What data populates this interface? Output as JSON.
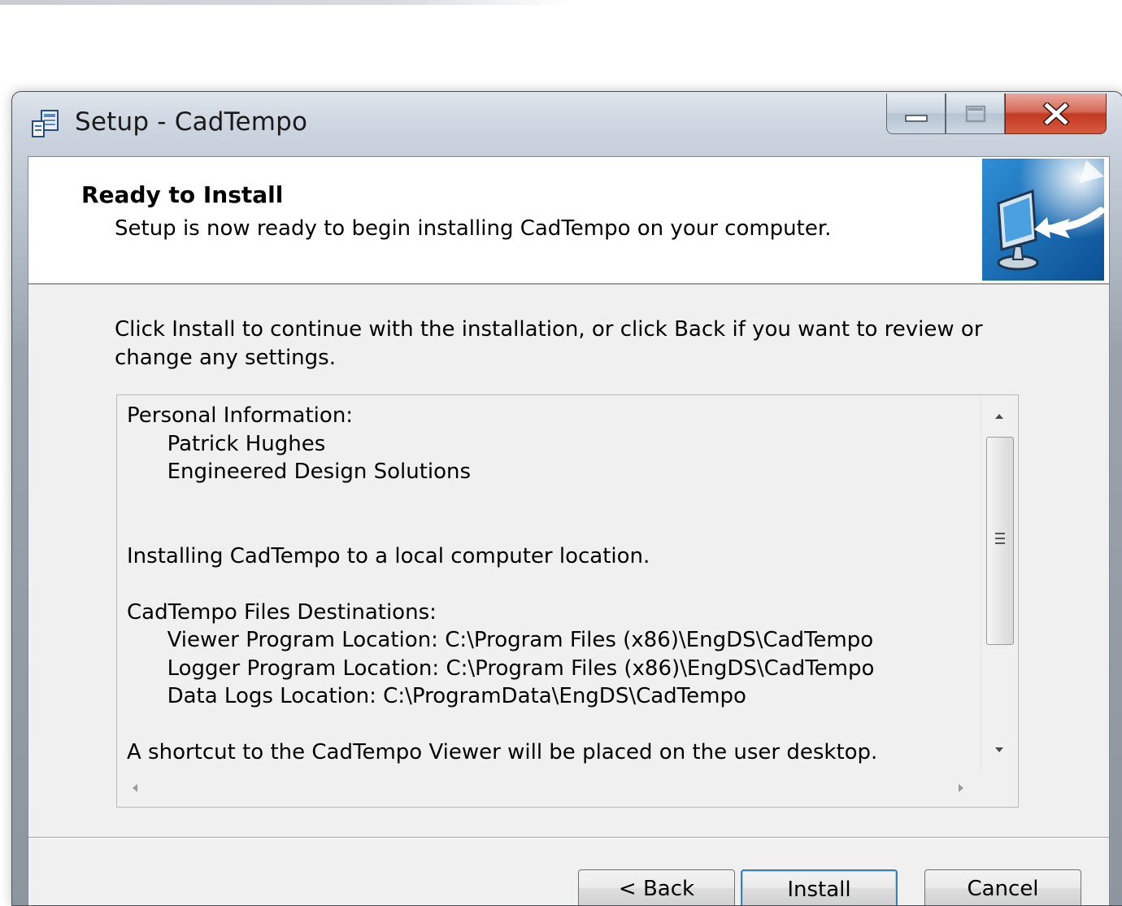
{
  "window": {
    "title": "Setup - CadTempo",
    "app_icon": "setup-installer-icon",
    "caption_buttons": [
      "minimize-icon",
      "maximize-icon",
      "close-icon"
    ]
  },
  "header": {
    "title": "Ready to Install",
    "subtitle": "Setup is now ready to begin installing CadTempo on your computer.",
    "image": "monitor-install-arrow-icon"
  },
  "intro": "Click Install to continue with the installation, or click Back if you want to review or change any settings.",
  "memo": {
    "lines": [
      "Personal Information:",
      "      Patrick Hughes",
      "      Engineered Design Solutions",
      "",
      "",
      "Installing CadTempo to a local computer location.",
      "",
      "CadTempo Files Destinations:",
      "      Viewer Program Location: C:\\Program Files (x86)\\EngDS\\CadTempo",
      "      Logger Program Location: C:\\Program Files (x86)\\EngDS\\CadTempo",
      "      Data Logs Location: C:\\ProgramData\\EngDS\\CadTempo",
      "",
      "A shortcut to the CadTempo Viewer will be placed on the user desktop."
    ]
  },
  "buttons": {
    "back": "< Back",
    "install": "Install",
    "cancel": "Cancel"
  }
}
